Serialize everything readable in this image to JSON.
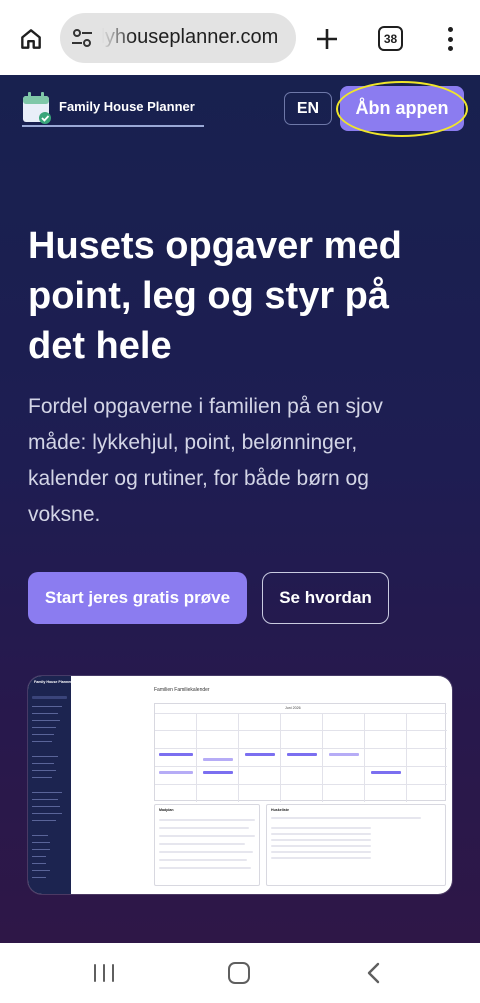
{
  "browser": {
    "url": "ilyhouseplanner.com",
    "tab_count": "38",
    "icons": [
      "home-icon",
      "tune-icon",
      "plus-icon",
      "tabs-icon",
      "more-vert-icon"
    ]
  },
  "header": {
    "logo_text": "Family House Planner",
    "lang_label": "EN",
    "open_app_label": "Åbn appen"
  },
  "hero": {
    "title": "Husets opgaver med point, leg og styr på det hele",
    "subtitle": "Fordel opgaverne i familien på en sjov måde: lykkehjul, point, belønninger, kalender og rutiner, for både børn og voksne.",
    "cta_primary": "Start jeres gratis prøve",
    "cta_secondary": "Se hvordan"
  },
  "preview": {
    "brand": "Family House Planner",
    "calendar_title": "Familien Familiekalender",
    "month": "Juni 2026",
    "panel_left_title": "Madplan",
    "panel_right_title": "Huskeliste"
  },
  "colors": {
    "accent": "#8b7cf0",
    "highlight": "#f0e62a",
    "page_bg": "#1e1d52"
  },
  "nav": {
    "icons": [
      "recents-icon",
      "home-circle-icon",
      "back-icon"
    ]
  }
}
